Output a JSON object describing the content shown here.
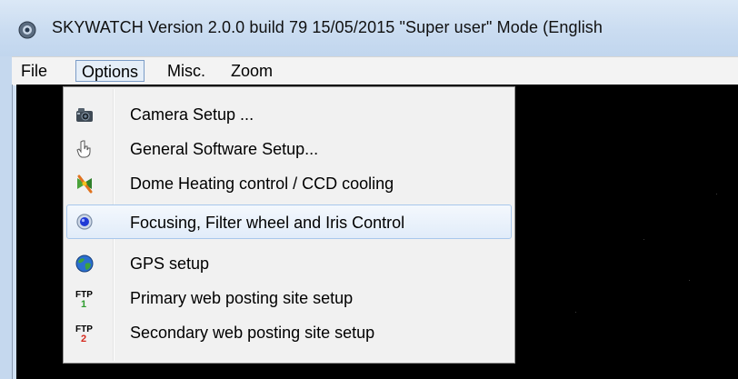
{
  "window": {
    "title": "SKYWATCH Version  2.0.0 build 79 15/05/2015 \"Super user\" Mode  (English"
  },
  "menubar": {
    "items": [
      {
        "label": "File"
      },
      {
        "label": "Options"
      },
      {
        "label": "Misc."
      },
      {
        "label": "Zoom"
      }
    ]
  },
  "options_menu": {
    "items": [
      {
        "label": "Camera Setup ...",
        "icon": "camera-icon"
      },
      {
        "label": "General Software Setup...",
        "icon": "hand-pointer-icon"
      },
      {
        "label": "Dome Heating control / CCD cooling",
        "icon": "thermometer-fan-icon"
      },
      {
        "label": "Focusing, Filter wheel and Iris Control",
        "icon": "lens-icon"
      },
      {
        "label": "GPS setup",
        "icon": "globe-icon"
      },
      {
        "label": "Primary web posting site setup",
        "icon": "ftp-1-icon"
      },
      {
        "label": "Secondary web posting site setup",
        "icon": "ftp-2-icon"
      }
    ]
  },
  "colors": {
    "titlebar": "#cadcf1",
    "canvas": "#000000",
    "menu_hover_border": "#a8c7ec",
    "ftp_1_accent": "#2e9c2e",
    "ftp_2_accent": "#d62a1e"
  }
}
